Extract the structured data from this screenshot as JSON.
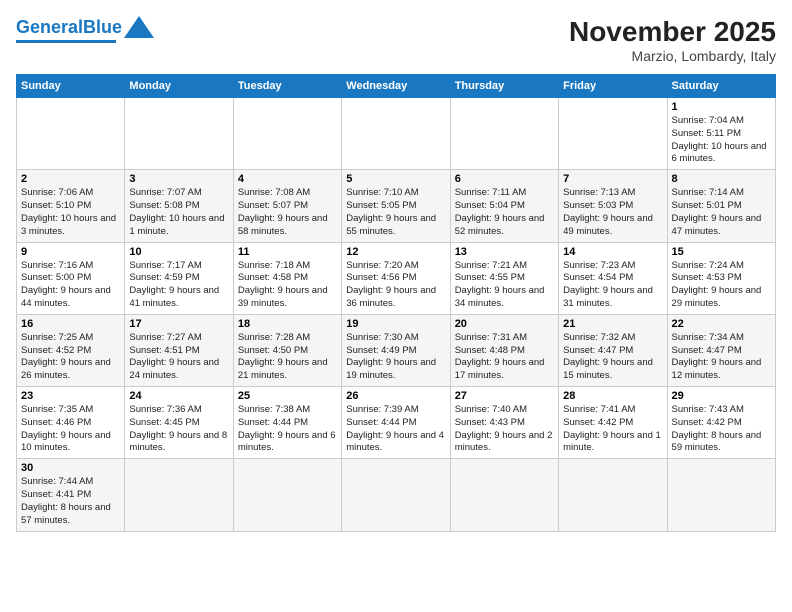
{
  "header": {
    "logo_general": "General",
    "logo_blue": "Blue",
    "title": "November 2025",
    "subtitle": "Marzio, Lombardy, Italy"
  },
  "days_of_week": [
    "Sunday",
    "Monday",
    "Tuesday",
    "Wednesday",
    "Thursday",
    "Friday",
    "Saturday"
  ],
  "weeks": [
    [
      {
        "day": "",
        "info": ""
      },
      {
        "day": "",
        "info": ""
      },
      {
        "day": "",
        "info": ""
      },
      {
        "day": "",
        "info": ""
      },
      {
        "day": "",
        "info": ""
      },
      {
        "day": "",
        "info": ""
      },
      {
        "day": "1",
        "info": "Sunrise: 7:04 AM\nSunset: 5:11 PM\nDaylight: 10 hours and 6 minutes."
      }
    ],
    [
      {
        "day": "2",
        "info": "Sunrise: 7:06 AM\nSunset: 5:10 PM\nDaylight: 10 hours and 3 minutes."
      },
      {
        "day": "3",
        "info": "Sunrise: 7:07 AM\nSunset: 5:08 PM\nDaylight: 10 hours and 1 minute."
      },
      {
        "day": "4",
        "info": "Sunrise: 7:08 AM\nSunset: 5:07 PM\nDaylight: 9 hours and 58 minutes."
      },
      {
        "day": "5",
        "info": "Sunrise: 7:10 AM\nSunset: 5:05 PM\nDaylight: 9 hours and 55 minutes."
      },
      {
        "day": "6",
        "info": "Sunrise: 7:11 AM\nSunset: 5:04 PM\nDaylight: 9 hours and 52 minutes."
      },
      {
        "day": "7",
        "info": "Sunrise: 7:13 AM\nSunset: 5:03 PM\nDaylight: 9 hours and 49 minutes."
      },
      {
        "day": "8",
        "info": "Sunrise: 7:14 AM\nSunset: 5:01 PM\nDaylight: 9 hours and 47 minutes."
      }
    ],
    [
      {
        "day": "9",
        "info": "Sunrise: 7:16 AM\nSunset: 5:00 PM\nDaylight: 9 hours and 44 minutes."
      },
      {
        "day": "10",
        "info": "Sunrise: 7:17 AM\nSunset: 4:59 PM\nDaylight: 9 hours and 41 minutes."
      },
      {
        "day": "11",
        "info": "Sunrise: 7:18 AM\nSunset: 4:58 PM\nDaylight: 9 hours and 39 minutes."
      },
      {
        "day": "12",
        "info": "Sunrise: 7:20 AM\nSunset: 4:56 PM\nDaylight: 9 hours and 36 minutes."
      },
      {
        "day": "13",
        "info": "Sunrise: 7:21 AM\nSunset: 4:55 PM\nDaylight: 9 hours and 34 minutes."
      },
      {
        "day": "14",
        "info": "Sunrise: 7:23 AM\nSunset: 4:54 PM\nDaylight: 9 hours and 31 minutes."
      },
      {
        "day": "15",
        "info": "Sunrise: 7:24 AM\nSunset: 4:53 PM\nDaylight: 9 hours and 29 minutes."
      }
    ],
    [
      {
        "day": "16",
        "info": "Sunrise: 7:25 AM\nSunset: 4:52 PM\nDaylight: 9 hours and 26 minutes."
      },
      {
        "day": "17",
        "info": "Sunrise: 7:27 AM\nSunset: 4:51 PM\nDaylight: 9 hours and 24 minutes."
      },
      {
        "day": "18",
        "info": "Sunrise: 7:28 AM\nSunset: 4:50 PM\nDaylight: 9 hours and 21 minutes."
      },
      {
        "day": "19",
        "info": "Sunrise: 7:30 AM\nSunset: 4:49 PM\nDaylight: 9 hours and 19 minutes."
      },
      {
        "day": "20",
        "info": "Sunrise: 7:31 AM\nSunset: 4:48 PM\nDaylight: 9 hours and 17 minutes."
      },
      {
        "day": "21",
        "info": "Sunrise: 7:32 AM\nSunset: 4:47 PM\nDaylight: 9 hours and 15 minutes."
      },
      {
        "day": "22",
        "info": "Sunrise: 7:34 AM\nSunset: 4:47 PM\nDaylight: 9 hours and 12 minutes."
      }
    ],
    [
      {
        "day": "23",
        "info": "Sunrise: 7:35 AM\nSunset: 4:46 PM\nDaylight: 9 hours and 10 minutes."
      },
      {
        "day": "24",
        "info": "Sunrise: 7:36 AM\nSunset: 4:45 PM\nDaylight: 9 hours and 8 minutes."
      },
      {
        "day": "25",
        "info": "Sunrise: 7:38 AM\nSunset: 4:44 PM\nDaylight: 9 hours and 6 minutes."
      },
      {
        "day": "26",
        "info": "Sunrise: 7:39 AM\nSunset: 4:44 PM\nDaylight: 9 hours and 4 minutes."
      },
      {
        "day": "27",
        "info": "Sunrise: 7:40 AM\nSunset: 4:43 PM\nDaylight: 9 hours and 2 minutes."
      },
      {
        "day": "28",
        "info": "Sunrise: 7:41 AM\nSunset: 4:42 PM\nDaylight: 9 hours and 1 minute."
      },
      {
        "day": "29",
        "info": "Sunrise: 7:43 AM\nSunset: 4:42 PM\nDaylight: 8 hours and 59 minutes."
      }
    ],
    [
      {
        "day": "30",
        "info": "Sunrise: 7:44 AM\nSunset: 4:41 PM\nDaylight: 8 hours and 57 minutes."
      },
      {
        "day": "",
        "info": ""
      },
      {
        "day": "",
        "info": ""
      },
      {
        "day": "",
        "info": ""
      },
      {
        "day": "",
        "info": ""
      },
      {
        "day": "",
        "info": ""
      },
      {
        "day": "",
        "info": ""
      }
    ]
  ]
}
